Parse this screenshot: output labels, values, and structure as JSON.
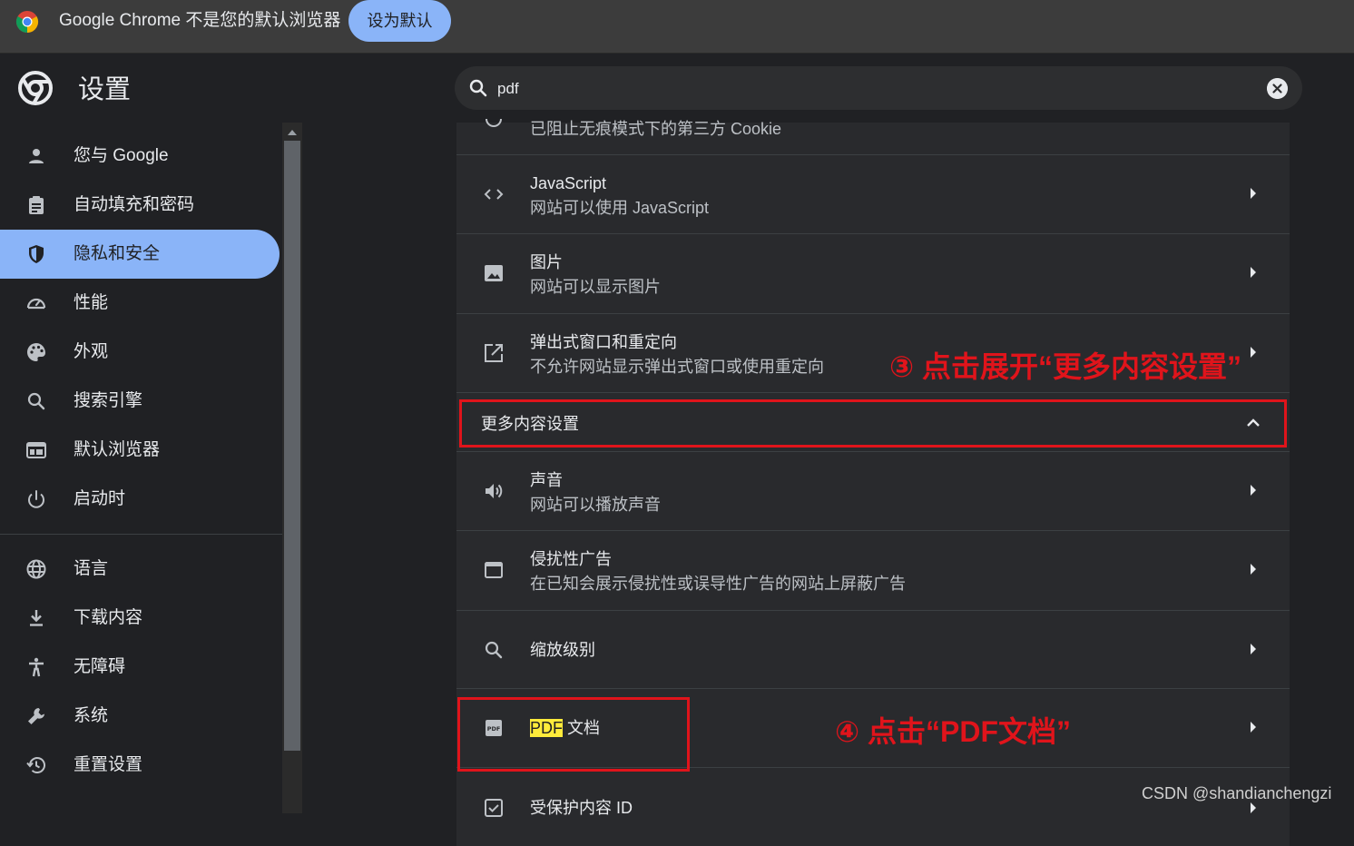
{
  "infobar": {
    "message": "Google Chrome 不是您的默认浏览器",
    "button": "设为默认"
  },
  "header": {
    "title": "设置",
    "search_value": "pdf"
  },
  "sidebar": {
    "items": [
      {
        "label": "您与 Google",
        "icon": "person-icon"
      },
      {
        "label": "自动填充和密码",
        "icon": "clipboard-icon"
      },
      {
        "label": "隐私和安全",
        "icon": "shield-icon",
        "active": true
      },
      {
        "label": "性能",
        "icon": "speedometer-icon"
      },
      {
        "label": "外观",
        "icon": "palette-icon"
      },
      {
        "label": "搜索引擎",
        "icon": "search-icon"
      },
      {
        "label": "默认浏览器",
        "icon": "browser-icon"
      },
      {
        "label": "启动时",
        "icon": "power-icon"
      },
      {
        "label": "语言",
        "icon": "globe-icon"
      },
      {
        "label": "下载内容",
        "icon": "download-icon"
      },
      {
        "label": "无障碍",
        "icon": "accessibility-icon"
      },
      {
        "label": "系统",
        "icon": "wrench-icon"
      },
      {
        "label": "重置设置",
        "icon": "history-icon"
      }
    ]
  },
  "content": {
    "partial_row_text": "已阻止无痕模式下的第三方 Cookie",
    "rows_top": [
      {
        "title": "JavaScript",
        "subtitle": "网站可以使用 JavaScript",
        "icon": "code-icon"
      },
      {
        "title": "图片",
        "subtitle": "网站可以显示图片",
        "icon": "image-icon"
      },
      {
        "title": "弹出式窗口和重定向",
        "subtitle": "不允许网站显示弹出式窗口或使用重定向",
        "icon": "open-in-new-icon"
      }
    ],
    "section_more": "更多内容设置",
    "rows_more": [
      {
        "title": "声音",
        "subtitle": "网站可以播放声音",
        "icon": "volume-icon"
      },
      {
        "title": "侵扰性广告",
        "subtitle": "在已知会展示侵扰性或误导性广告的网站上屏蔽广告",
        "icon": "window-icon"
      },
      {
        "title": "缩放级别",
        "icon": "zoom-icon"
      }
    ],
    "pdf_row": {
      "highlight": "PDF",
      "rest": " 文档"
    },
    "protected_row": "受保护内容 ID"
  },
  "annotations": {
    "step3": "③ 点击展开“更多内容设置”",
    "step4": "④ 点击“PDF文档”"
  },
  "watermark": "CSDN @shandianchengzi",
  "colors": {
    "accent": "#8ab4f8",
    "annotation_red": "#e0141b",
    "highlight": "#ffeb3b"
  }
}
